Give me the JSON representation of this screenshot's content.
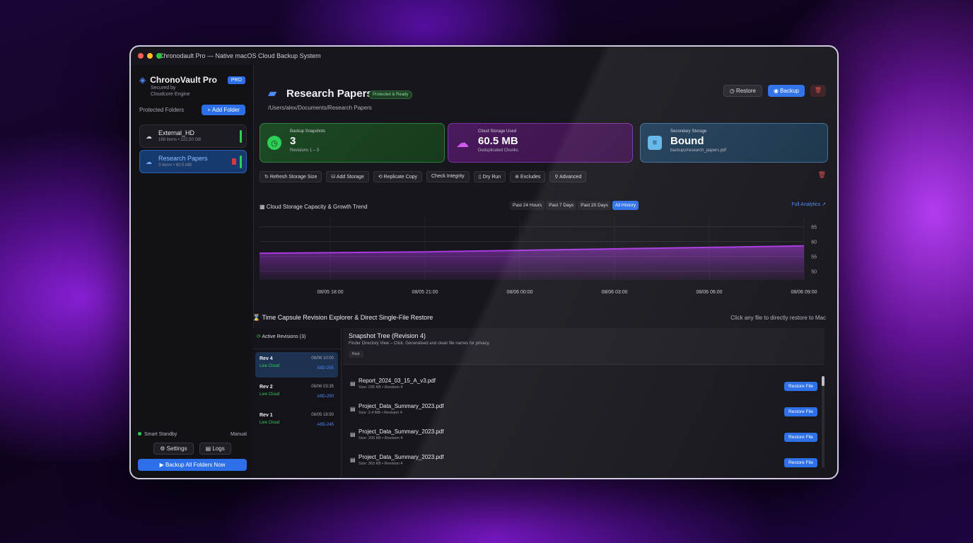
{
  "window": {
    "title": "Chronodault Pro — Native macOS Cloud Backup System"
  },
  "sidebar": {
    "brand_name": "ChronoVault Pro",
    "brand_sub_1": "Secured by",
    "brand_sub_2": "Cloudcore Engine",
    "pro_badge": "PRO",
    "protected_label": "Protected Folders",
    "add_folder": "+ Add Folder",
    "folders": [
      {
        "name": "External_HD",
        "meta": "168 items • 222.50 GB"
      },
      {
        "name": "Research Papers",
        "meta": "3 items • 60.5 MB"
      }
    ],
    "standby": "Smart Standby",
    "mode": "Manual",
    "settings": "Settings",
    "logs": "Logs",
    "backup_all": "Backup All Folders Now"
  },
  "header": {
    "title": "Research Papers",
    "badge": "Protected & Ready",
    "path": "/Users/alex/Documents/Research Papers",
    "restore": "Restore",
    "backup": "Backup"
  },
  "stats": [
    {
      "label": "Backup Snapshots",
      "value": "3",
      "sub": "Revisions 1 – 3"
    },
    {
      "label": "Cloud Storage Used",
      "value": "60.5 MB",
      "sub": "Deduplicated Chunks"
    },
    {
      "label": "Secondary Storage",
      "value": "Bound",
      "sub": "backups/research_papers.pdf"
    }
  ],
  "toolbar": [
    "Refresh Storage Size",
    "Add Storage",
    "Replicate Copy",
    "Check Integrity",
    "Dry Run",
    "Excludes",
    "Advanced"
  ],
  "chart": {
    "title": "Cloud Storage Capacity & Growth Trend",
    "ranges": [
      "Past 24 Hours",
      "Past 7 Days",
      "Past 20 Days",
      "All History"
    ],
    "active_range": "All History",
    "full_analytics": "Full Analytics ↗"
  },
  "chart_data": {
    "type": "area",
    "title": "Cloud Storage Capacity & Growth Trend",
    "x": [
      "08/05 18:00",
      "08/05 21:00",
      "08/06 00:00",
      "08/06 03:00",
      "08/06 06:00",
      "08/06 09:00"
    ],
    "series": [
      {
        "values": [
          56,
          56.5,
          57,
          57.5,
          58,
          58.5
        ]
      }
    ],
    "yticks": [
      50,
      55,
      60,
      65
    ],
    "ylim": [
      47,
      68
    ],
    "grid": true,
    "color": "#a838e0"
  },
  "timecapsule": {
    "title": "Time Capsule Revision Explorer & Direct Single-File Restore",
    "hint": "Click any file to directly restore to Mac",
    "active_revisions": "Active Revisions (3)",
    "revisions": [
      {
        "name": "Rev 4",
        "time": "08/06 10:00",
        "status": "Live Cloud",
        "code": "A8D-255"
      },
      {
        "name": "Rev 2",
        "time": "08/06 03:35",
        "status": "Live Cloud",
        "code": "A8D-250"
      },
      {
        "name": "Rev 1",
        "time": "08/05 18:50",
        "status": "Live Cloud",
        "code": "A8D-245"
      }
    ],
    "snapshot_title": "Snapshot Tree (Revision 4)",
    "snapshot_desc": "Finder Directory View – Click. Generalised and clean file names for privacy.",
    "snapshot_chip": "Root",
    "files": [
      {
        "name": "Report_2024_03_15_A_v3.pdf",
        "meta": "Size: 235 KB • Revision 4"
      },
      {
        "name": "Project_Data_Summary_2023.pdf",
        "meta": "Size: 2.4 MB • Revision 4"
      },
      {
        "name": "Project_Data_Summary_2023.pdf",
        "meta": "Size: 200 KB • Revision 4"
      },
      {
        "name": "Project_Data_Summary_2023.pdf",
        "meta": "Size: 363 KB • Revision 4"
      }
    ],
    "restore_file": "Restore File"
  }
}
